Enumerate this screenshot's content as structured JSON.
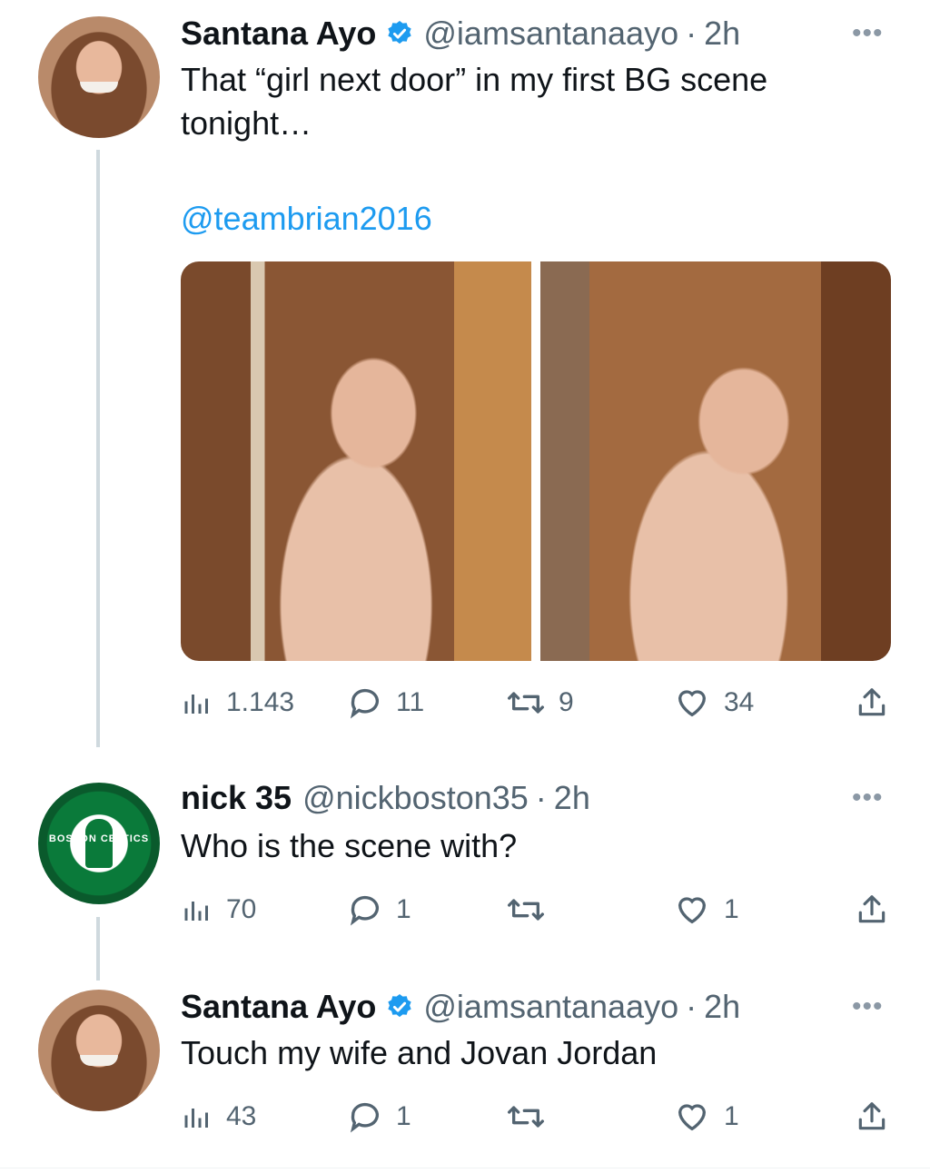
{
  "tweets": [
    {
      "author": {
        "name": "Santana Ayo",
        "handle": "@iamsantanaayo",
        "verified": true,
        "avatar": "woman-portrait-avatar"
      },
      "time": "2h",
      "text_line1": "That “girl next door” in my first BG scene",
      "text_line2": "tonight…",
      "mention": "@teambrian2016",
      "media": [
        "selfie-photo-left",
        "selfie-photo-right"
      ],
      "stats": {
        "views": "1.143",
        "replies": "11",
        "retweets": "9",
        "likes": "34"
      }
    },
    {
      "author": {
        "name": "nick 35",
        "handle": "@nickboston35",
        "verified": false,
        "avatar": "boston-celtics-logo",
        "avatar_text": "BOSTON CELTICS"
      },
      "time": "2h",
      "text": "Who is the scene with?",
      "stats": {
        "views": "70",
        "replies": "1",
        "retweets": "",
        "likes": "1"
      }
    },
    {
      "author": {
        "name": "Santana Ayo",
        "handle": "@iamsantanaayo",
        "verified": true,
        "avatar": "woman-portrait-avatar"
      },
      "time": "2h",
      "text": "Touch my wife and Jovan Jordan",
      "stats": {
        "views": "43",
        "replies": "1",
        "retweets": "",
        "likes": "1"
      }
    }
  ],
  "ui": {
    "separator_dot": "·",
    "more": "•••"
  },
  "colors": {
    "verified": "#1d9bf0",
    "link": "#1d9bf0",
    "muted": "#536471",
    "thread_line": "#cfd9de"
  }
}
